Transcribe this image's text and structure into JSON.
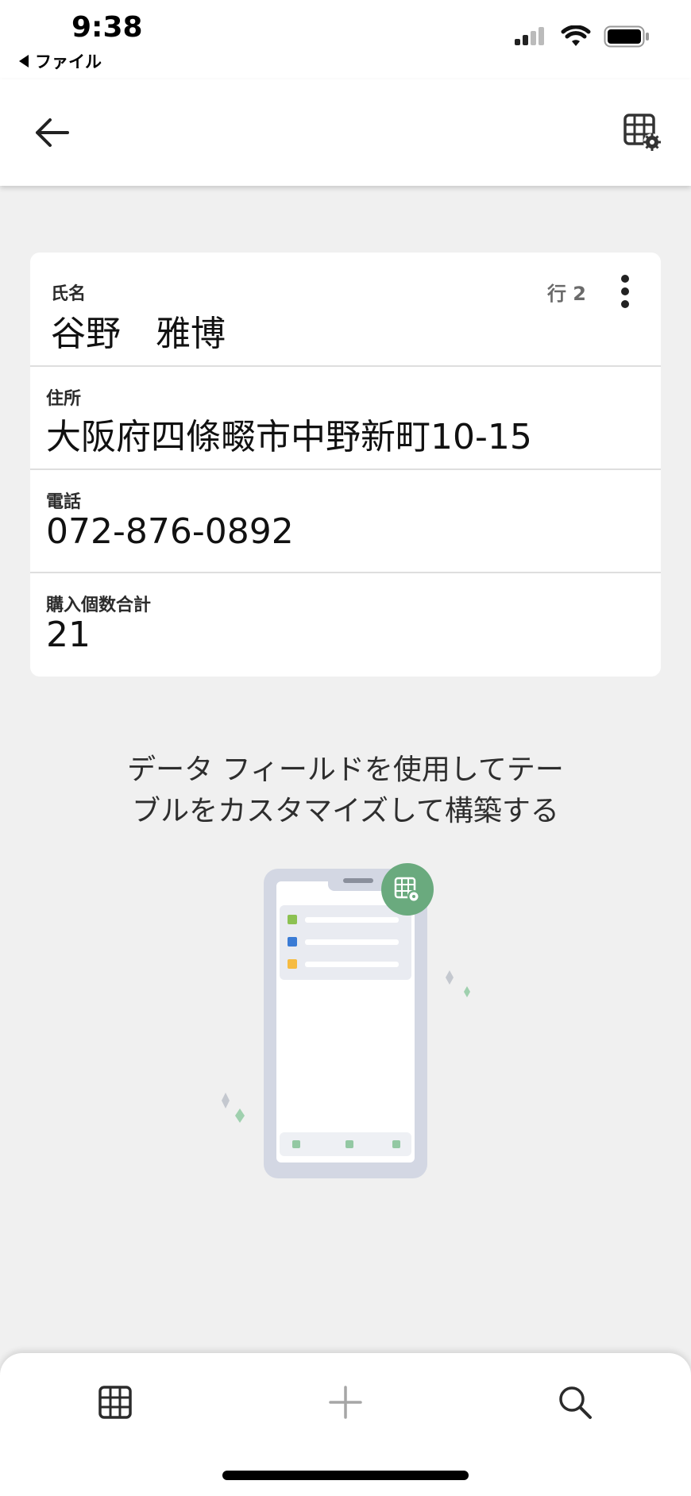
{
  "status_bar": {
    "time": "9:38",
    "back_app": "ファイル"
  },
  "app_bar": {
    "back_icon": "arrow-left-icon",
    "settings_icon": "table-settings-icon"
  },
  "record": {
    "row_label": "行 2",
    "fields": [
      {
        "label": "氏名",
        "value": "谷野　雅博"
      },
      {
        "label": "住所",
        "value": "大阪府四條畷市中野新町10-15"
      },
      {
        "label": "電話",
        "value": "072-876-0892"
      },
      {
        "label": "購入個数合計",
        "value": "21"
      }
    ]
  },
  "promo": {
    "line1": "データ フィールドを使用してテー",
    "line2": "ブルをカスタマイズして構築する"
  },
  "bottom_nav": {
    "items": [
      "table-icon",
      "add-icon",
      "search-icon"
    ]
  },
  "colors": {
    "accent_green": "#6aaa7e",
    "background": "#f0f0f0",
    "card": "#ffffff"
  }
}
